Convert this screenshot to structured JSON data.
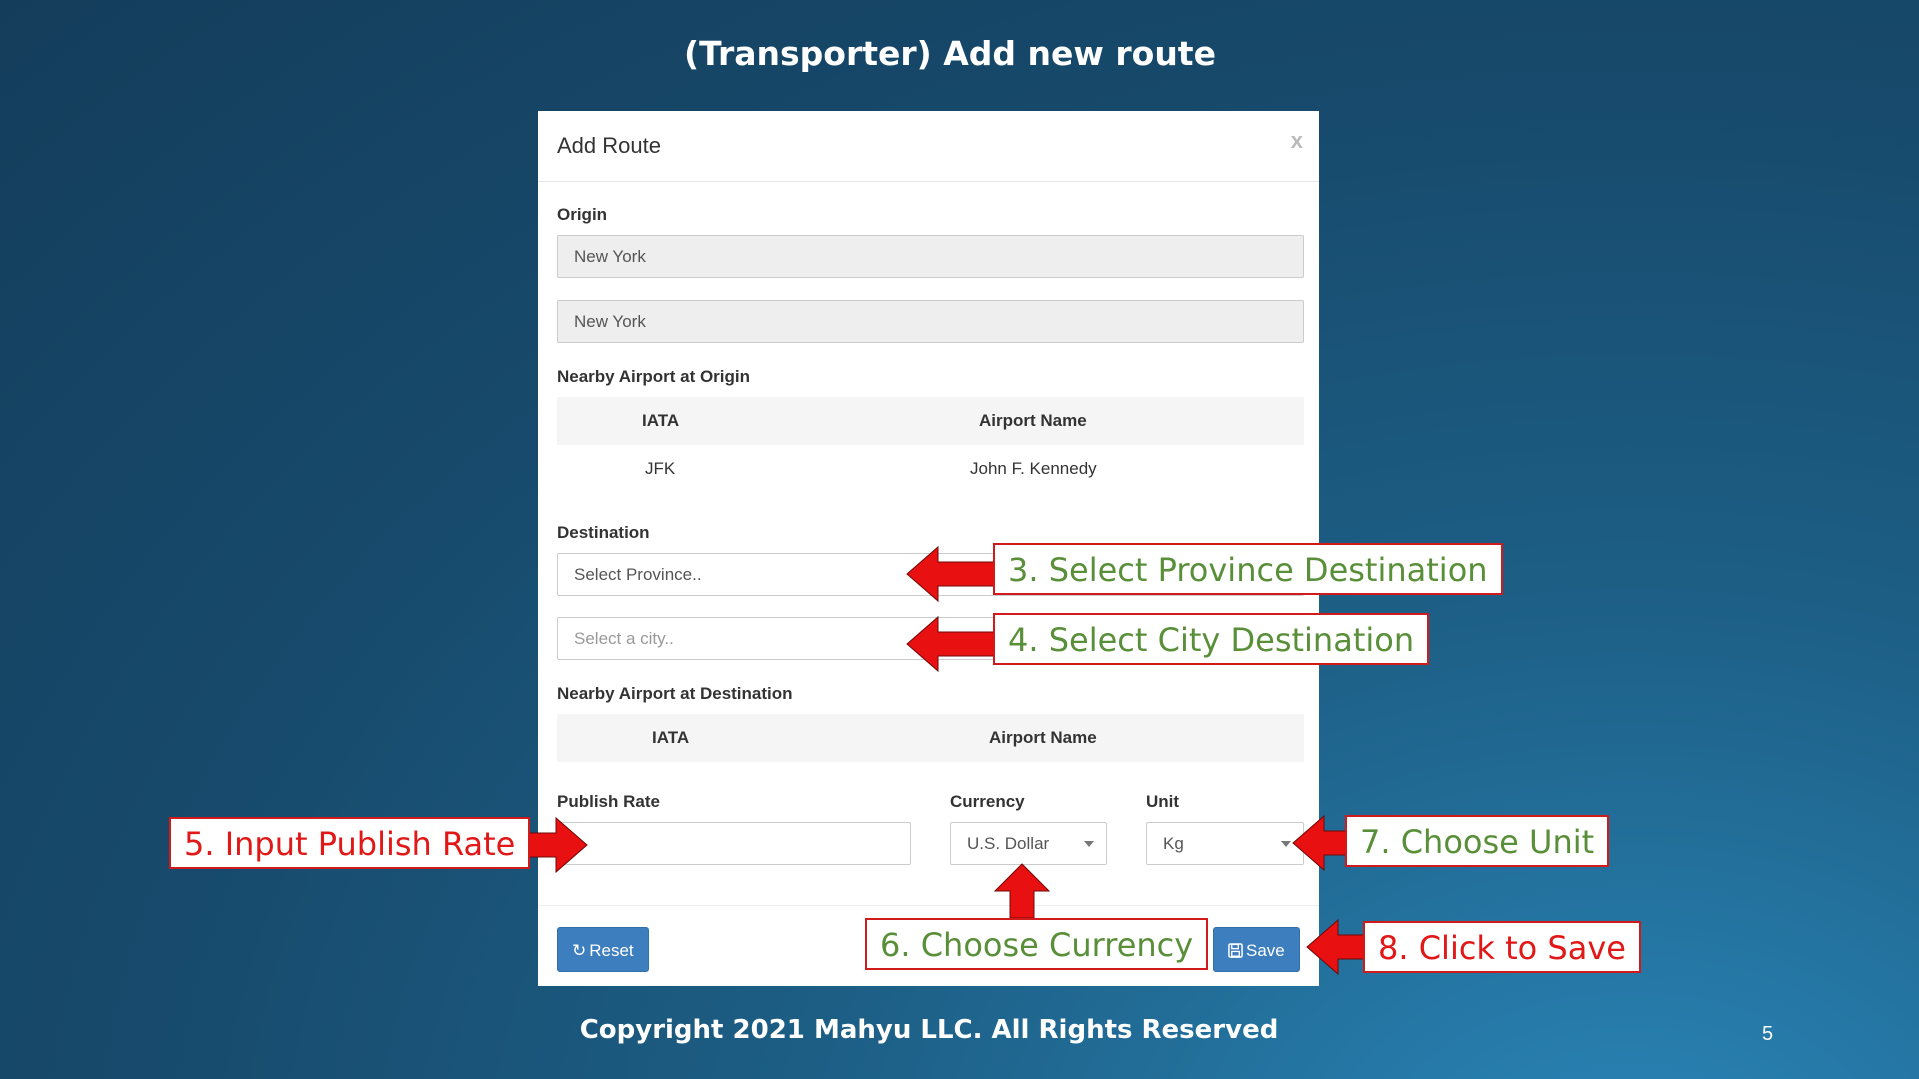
{
  "slide": {
    "title": "(Transporter) Add new route",
    "footer": "Copyright 2021 Mahyu LLC. All Rights Reserved",
    "page_number": "5"
  },
  "modal": {
    "title": "Add Route",
    "close_label": "x",
    "origin": {
      "label": "Origin",
      "province_value": "New York",
      "city_value": "New York"
    },
    "nearby_origin": {
      "label": "Nearby Airport at Origin",
      "columns": [
        "IATA",
        "Airport Name"
      ],
      "rows": [
        [
          "JFK",
          "John F. Kennedy"
        ]
      ]
    },
    "destination": {
      "label": "Destination",
      "province_placeholder": "Select Province..",
      "city_placeholder": "Select a city.."
    },
    "nearby_destination": {
      "label": "Nearby Airport at Destination",
      "columns": [
        "IATA",
        "Airport Name"
      ]
    },
    "publish_rate": {
      "label": "Publish Rate",
      "value": ""
    },
    "currency": {
      "label": "Currency",
      "selected": "U.S. Dollar"
    },
    "unit": {
      "label": "Unit",
      "selected": "Kg"
    },
    "buttons": {
      "reset": "Reset",
      "save": "Save"
    }
  },
  "callouts": {
    "step3": "3. Select Province Destination",
    "step4": "4. Select City Destination",
    "step5": "5. Input Publish Rate",
    "step6": "6. Choose Currency",
    "step7": "7. Choose Unit",
    "step8": "8. Click to Save"
  },
  "colors": {
    "callout_green_text": "#5a8f3a",
    "callout_red_text": "#e01818",
    "arrow_red": "#e81010",
    "button_blue": "#3d7ebf"
  },
  "icons": {
    "reset": "refresh-icon",
    "save": "floppy-disk-icon",
    "caret": "caret-down-icon"
  }
}
